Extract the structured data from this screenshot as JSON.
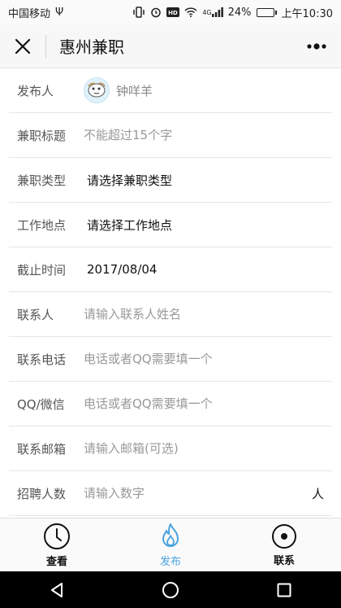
{
  "status": {
    "carrier": "中国移动",
    "usb_glyph": "Ψ",
    "network": "4G",
    "battery": "24%",
    "battery_level": 0.24,
    "time": "上午10:30"
  },
  "header": {
    "title": "惠州兼职"
  },
  "form": {
    "publisher": {
      "label": "发布人",
      "name": "钟咩羊"
    },
    "title": {
      "label": "兼职标题",
      "placeholder": "不能超过15个字"
    },
    "type": {
      "label": "兼职类型",
      "value": "请选择兼职类型"
    },
    "location": {
      "label": "工作地点",
      "value": "请选择工作地点"
    },
    "deadline": {
      "label": "截止时间",
      "value": "2017/08/04"
    },
    "contact": {
      "label": "联系人",
      "placeholder": "请输入联系人姓名"
    },
    "phone": {
      "label": "联系电话",
      "placeholder": "电话或者QQ需要填一个"
    },
    "qq": {
      "label": "QQ/微信",
      "placeholder": "电话或者QQ需要填一个"
    },
    "email": {
      "label": "联系邮箱",
      "placeholder": "请输入邮箱(可选)"
    },
    "headcount": {
      "label": "招聘人数",
      "placeholder": "请输入数字",
      "suffix": "人"
    }
  },
  "tabbar": {
    "items": [
      {
        "label": "查看",
        "icon": "clock-icon"
      },
      {
        "label": "发布",
        "icon": "flame-icon"
      },
      {
        "label": "联系",
        "icon": "target-icon"
      }
    ],
    "active_color": "#4aa3df"
  }
}
